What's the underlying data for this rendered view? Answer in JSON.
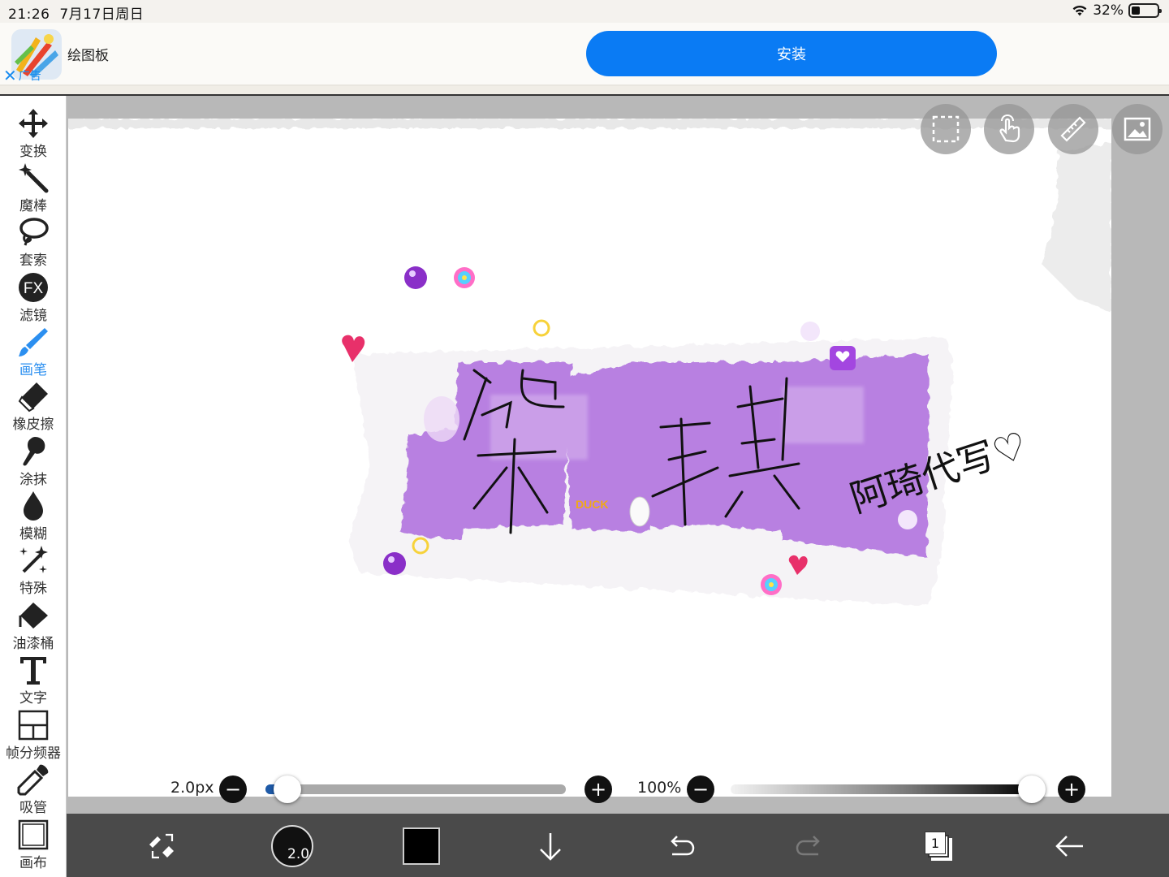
{
  "status_bar": {
    "time": "21:26",
    "date": "7月17日周日",
    "battery": "32%",
    "battery_level": 0.32
  },
  "ad": {
    "app_name": "绘图板",
    "ad_label": "广告",
    "install_label": "安装",
    "install_color": "#0a7bf4"
  },
  "tools": [
    {
      "label": "变换",
      "icon": "move-icon"
    },
    {
      "label": "魔棒",
      "icon": "magic-wand-icon"
    },
    {
      "label": "套索",
      "icon": "lasso-icon"
    },
    {
      "label": "滤镜",
      "icon": "fx-icon"
    },
    {
      "label": "画笔",
      "icon": "brush-icon",
      "active": true
    },
    {
      "label": "橡皮擦",
      "icon": "eraser-icon"
    },
    {
      "label": "涂抹",
      "icon": "smudge-icon"
    },
    {
      "label": "模糊",
      "icon": "blur-drop-icon"
    },
    {
      "label": "特殊",
      "icon": "sparkle-icon"
    },
    {
      "label": "油漆桶",
      "icon": "bucket-icon"
    },
    {
      "label": "文字",
      "icon": "text-icon"
    },
    {
      "label": "帧分频器",
      "icon": "frame-divider-icon"
    },
    {
      "label": "吸管",
      "icon": "eyedropper-icon"
    },
    {
      "label": "画布",
      "icon": "canvas-icon"
    }
  ],
  "canvas_overlay_buttons": [
    "selection-icon",
    "hand-touch-icon",
    "ruler-icon",
    "reference-image-icon"
  ],
  "brush_size": {
    "label": "2.0px",
    "value": 2.0,
    "fraction": 0.04
  },
  "opacity": {
    "label": "100%",
    "value": 100
  },
  "bottom_bar": {
    "brush_size_badge": "2.0",
    "current_color": "#000000",
    "layer_count": "1"
  },
  "artwork": {
    "main_text": "染琪",
    "signature": "阿琦代写♡",
    "sticker_text": "DUCK",
    "accent": "#b377e0"
  }
}
